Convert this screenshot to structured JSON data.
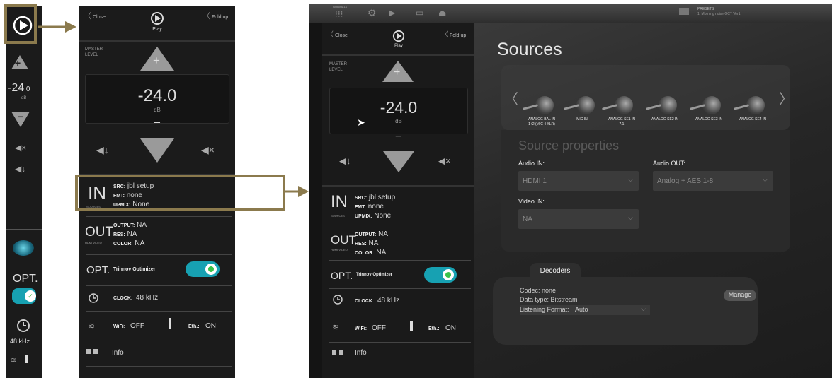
{
  "strip": {
    "level_value": "-24",
    "level_decimal": ".0",
    "level_unit": "dB",
    "opt_label": "OPT.",
    "clock_value": "48 kHz"
  },
  "panel": {
    "close_label": "Close",
    "foldup_label": "Fold up",
    "logo_text": "Play",
    "master_label_1": "MASTER",
    "master_label_2": "LEVEL",
    "level_value": "-24.0",
    "level_unit": "dB",
    "in_big": "IN",
    "in_sub": "SOURCES",
    "src_label": "SRC:",
    "src_value": "jbl setup",
    "fmt_label": "FMT:",
    "fmt_value": "none",
    "upmix_label": "UPMIX:",
    "upmix_value": "None",
    "out_big": "OUT",
    "out_sub": "HDMI VIDEO",
    "output_label": "OUTPUT:",
    "output_value": "NA",
    "res_label": "RES:",
    "res_value": "NA",
    "color_label": "COLOR:",
    "color_value": "NA",
    "opt_label": "OPT.",
    "optimizer_label": "Trinnov Optimizer",
    "clock_label": "CLOCK:",
    "clock_value": "48 kHz",
    "wifi_label": "WiFi:",
    "wifi_value": "OFF",
    "eth_label": "Eth.:",
    "eth_value": "ON",
    "info_label": "Info"
  },
  "screen": {
    "tb_small": "GUIWALL1",
    "preset_title": "PRESETS",
    "preset_value": "1. Morning noise OCT Ver1",
    "sources_title": "Sources",
    "sources": [
      {
        "label": "ANALOG BAL IN",
        "label2": "1+2 (MIC 4 XLR)"
      },
      {
        "label": "MIC IN",
        "label2": ""
      },
      {
        "label": "ANALOG SE1 IN",
        "label2": "7.1"
      },
      {
        "label": "ANALOG SE2 IN",
        "label2": ""
      },
      {
        "label": "ANALOG SE3 IN",
        "label2": ""
      },
      {
        "label": "ANALOG SE4 IN",
        "label2": ""
      }
    ],
    "props_title": "Source properties",
    "audio_in_label": "Audio IN:",
    "audio_in_value": "HDMI 1",
    "audio_out_label": "Audio OUT:",
    "audio_out_value": "Analog + AES 1-8",
    "video_in_label": "Video IN:",
    "video_in_value": "NA",
    "decoders_tab": "Decoders",
    "codec_line": "Codec: none",
    "datatype_line": "Data type: Bitstream",
    "listen_label": "Listening Format:",
    "listen_value": "Auto",
    "manage_label": "Manage"
  },
  "colors": {
    "highlight": "#8b7a4d",
    "toggle": "#17a1b2",
    "panel_bg": "#1b1b1b"
  }
}
